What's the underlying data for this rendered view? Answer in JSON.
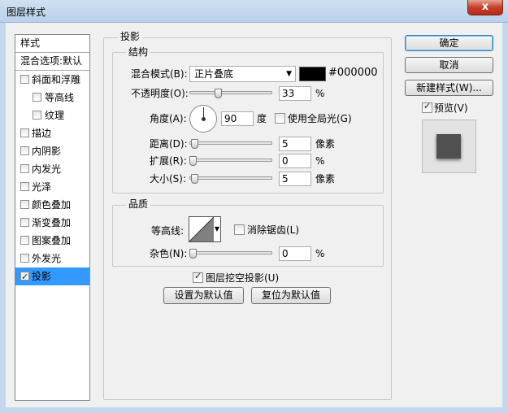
{
  "window": {
    "title": "图层样式",
    "close_label": "x"
  },
  "styles": {
    "header": "样式",
    "blend_options": "混合选项:默认",
    "items": [
      {
        "label": "斜面和浮雕",
        "checked": false,
        "level": 1
      },
      {
        "label": "等高线",
        "checked": false,
        "level": 2
      },
      {
        "label": "纹理",
        "checked": false,
        "level": 2
      },
      {
        "label": "描边",
        "checked": false,
        "level": 1
      },
      {
        "label": "内阴影",
        "checked": false,
        "level": 1
      },
      {
        "label": "内发光",
        "checked": false,
        "level": 1
      },
      {
        "label": "光泽",
        "checked": false,
        "level": 1
      },
      {
        "label": "颜色叠加",
        "checked": false,
        "level": 1
      },
      {
        "label": "渐变叠加",
        "checked": false,
        "level": 1
      },
      {
        "label": "图案叠加",
        "checked": false,
        "level": 1
      },
      {
        "label": "外发光",
        "checked": false,
        "level": 1
      },
      {
        "label": "投影",
        "checked": true,
        "level": 1,
        "active": true
      }
    ]
  },
  "drop_shadow": {
    "title": "投影",
    "structure": {
      "title": "结构",
      "blend_mode_label": "混合模式(B):",
      "blend_mode_value": "正片叠底",
      "color_hex": "#000000",
      "color": "#000000",
      "opacity_label": "不透明度(O):",
      "opacity_value": "33",
      "opacity_unit": "%",
      "opacity_fraction": 0.33,
      "angle_label": "角度(A):",
      "angle_value": "90",
      "angle_unit": "度",
      "global_light_label": "使用全局光(G)",
      "global_light_checked": false,
      "distance_label": "距离(D):",
      "distance_value": "5",
      "distance_unit": "像素",
      "spread_label": "扩展(R):",
      "spread_value": "0",
      "spread_unit": "%",
      "size_label": "大小(S):",
      "size_value": "5",
      "size_unit": "像素"
    },
    "quality": {
      "title": "品质",
      "contour_label": "等高线:",
      "anti_alias_label": "消除锯齿(L)",
      "anti_alias_checked": false,
      "noise_label": "杂色(N):",
      "noise_value": "0",
      "noise_unit": "%"
    },
    "knockout_label": "图层挖空投影(U)",
    "knockout_checked": true,
    "make_default_label": "设置为默认值",
    "reset_default_label": "复位为默认值"
  },
  "buttons": {
    "ok": "确定",
    "cancel": "取消",
    "new_style": "新建样式(W)...",
    "preview_label": "预览(V)",
    "preview_checked": true
  }
}
